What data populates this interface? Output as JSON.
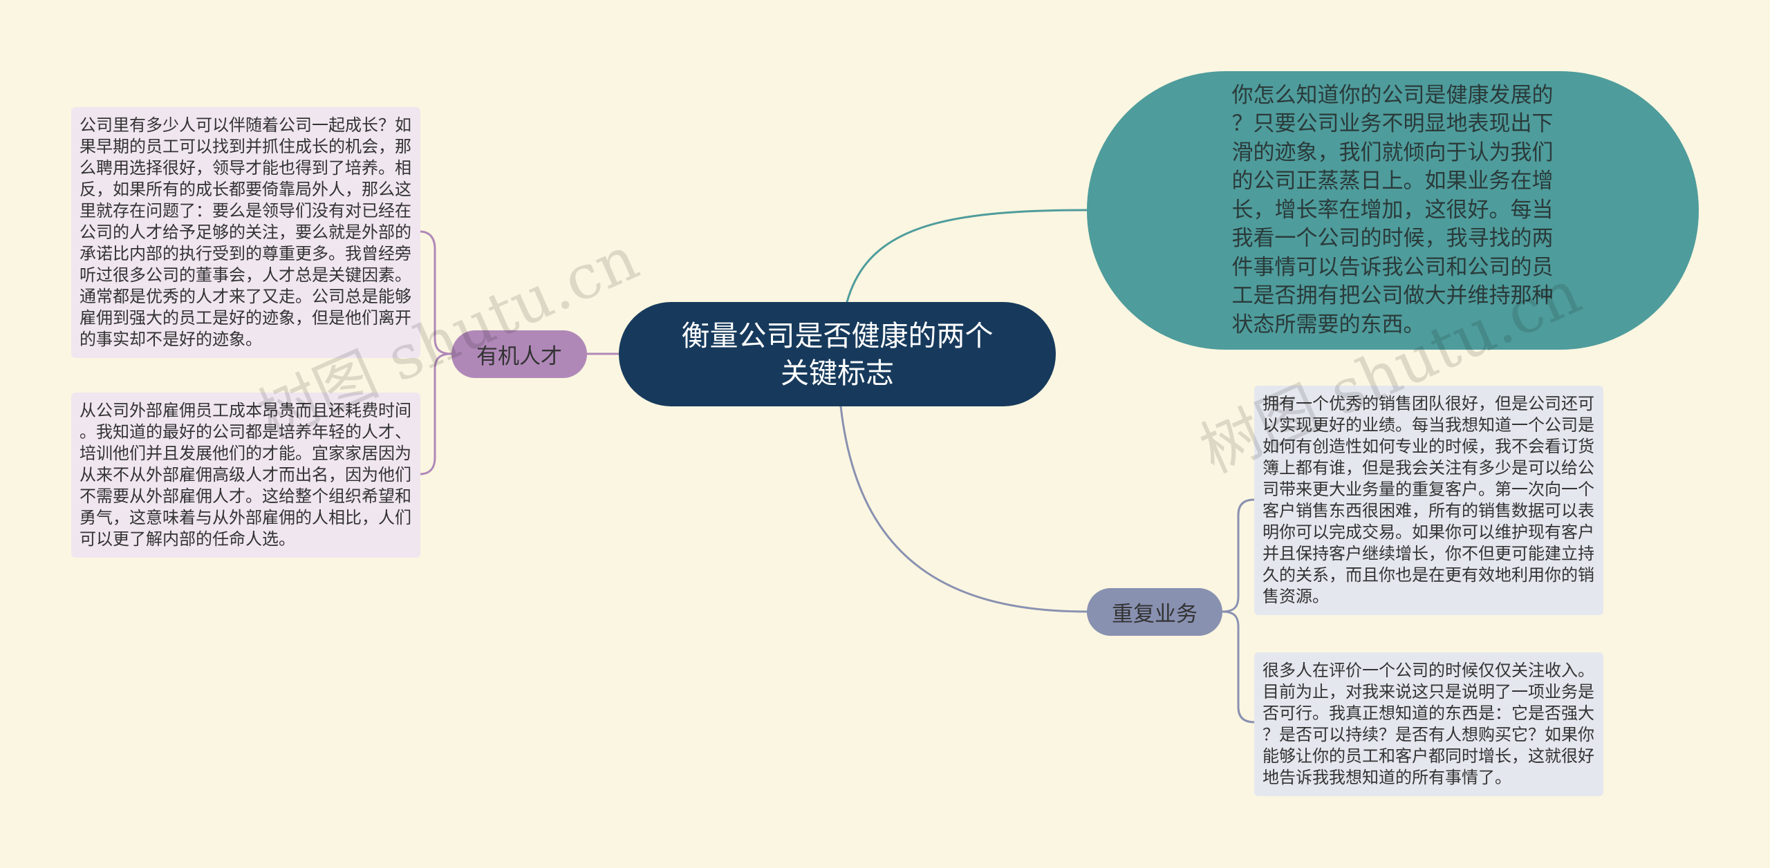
{
  "colors": {
    "bg": "#fbf6e1",
    "central": "#173a5c",
    "talent": "#b088b8",
    "intro": "#4f9c9c",
    "repeat": "#8991b1",
    "talent_note": "#f0e6f0",
    "repeat_note": "#e5e7ef"
  },
  "central": {
    "title": "衡量公司是否健康的两个关键标志"
  },
  "intro": {
    "text": "你怎么知道你的公司是健康发展的？只要公司业务不明显地表现出下滑的迹象，我们就倾向于认为我们的公司正蒸蒸日上。如果业务在增长，增长率在增加，这很好。每当我看一个公司的时候，我寻找的两件事情可以告诉我公司和公司的员工是否拥有把公司做大并维持那种状态所需要的东西。"
  },
  "talent": {
    "label": "有机人才",
    "notes": [
      "公司里有多少人可以伴随着公司一起成长？如果早期的员工可以找到并抓住成长的机会，那么聘用选择很好，领导才能也得到了培养。相反，如果所有的成长都要倚靠局外人，那么这里就存在问题了：要么是领导们没有对已经在公司的人才给予足够的关注，要么就是外部的承诺比内部的执行受到的尊重更多。我曾经旁听过很多公司的董事会，人才总是关键因素。通常都是优秀的人才来了又走。公司总是能够雇佣到强大的员工是好的迹象，但是他们离开的事实却不是好的迹象。",
      "从公司外部雇佣员工成本昂贵而且还耗费时间。我知道的最好的公司都是培养年轻的人才、培训他们并且发展他们的才能。宜家家居因为从来不从外部雇佣高级人才而出名，因为他们不需要从外部雇佣人才。这给整个组织希望和勇气，这意味着与从外部雇佣的人相比，人们可以更了解内部的任命人选。"
    ]
  },
  "repeat": {
    "label": "重复业务",
    "notes": [
      "拥有一个优秀的销售团队很好，但是公司还可以实现更好的业绩。每当我想知道一个公司是如何有创造性如何专业的时候，我不会看订货簿上都有谁，但是我会关注有多少是可以给公司带来更大业务量的重复客户。第一次向一个客户销售东西很困难，所有的销售数据可以表明你可以完成交易。如果你可以维护现有客户并且保持客户继续增长，你不但更可能建立持久的关系，而且你也是在更有效地利用你的销售资源。",
      "很多人在评价一个公司的时候仅仅关注收入。目前为止，对我来说这只是说明了一项业务是否可行。我真正想知道的东西是：它是否强大？是否可以持续？是否有人想购买它？如果你能够让你的员工和客户都同时增长，这就很好地告诉我我想知道的所有事情了。"
    ]
  },
  "watermark": "树图 shutu.cn"
}
